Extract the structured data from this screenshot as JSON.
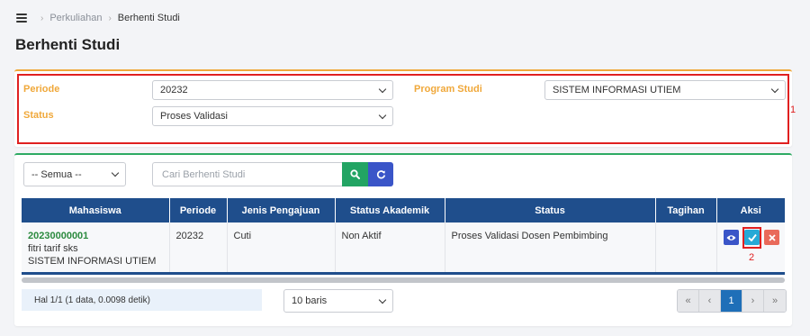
{
  "breadcrumb": {
    "items": [
      "Perkuliahan",
      "Berhenti Studi"
    ]
  },
  "page": {
    "title": "Berhenti Studi"
  },
  "filters": {
    "periode_label": "Periode",
    "periode_value": "20232",
    "status_label": "Status",
    "status_value": "Proses Validasi",
    "program_label": "Program Studi",
    "program_value": "SISTEM INFORMASI UTIEM",
    "marker": "1"
  },
  "toolbar": {
    "semua_value": "-- Semua --",
    "search_placeholder": "Cari Berhenti Studi"
  },
  "table": {
    "headers": [
      "Mahasiswa",
      "Periode",
      "Jenis Pengajuan",
      "Status Akademik",
      "Status",
      "Tagihan",
      "Aksi"
    ],
    "rows": [
      {
        "nim": "20230000001",
        "name": "fitri tarif sks",
        "prodi": "SISTEM INFORMASI UTIEM",
        "periode": "20232",
        "jenis": "Cuti",
        "status_akademik": "Non Aktif",
        "status": "Proses Validasi Dosen Pembimbing",
        "tagihan": ""
      }
    ],
    "marker": "2"
  },
  "footer": {
    "info": "Hal 1/1 (1 data, 0.0098 detik)",
    "rows_per_page": "10 baris",
    "pager": [
      "«",
      "‹",
      "1",
      "›",
      "»"
    ]
  },
  "colors": {
    "accent_orange": "#f0a83a",
    "header_blue": "#1f4e8c",
    "green": "#22a463",
    "blue_button": "#3a55c8",
    "red_marker": "#e02020"
  },
  "icons": [
    "menu-icon",
    "chevron-right-icon",
    "search-icon",
    "refresh-icon",
    "eye-icon",
    "check-icon",
    "close-icon"
  ]
}
